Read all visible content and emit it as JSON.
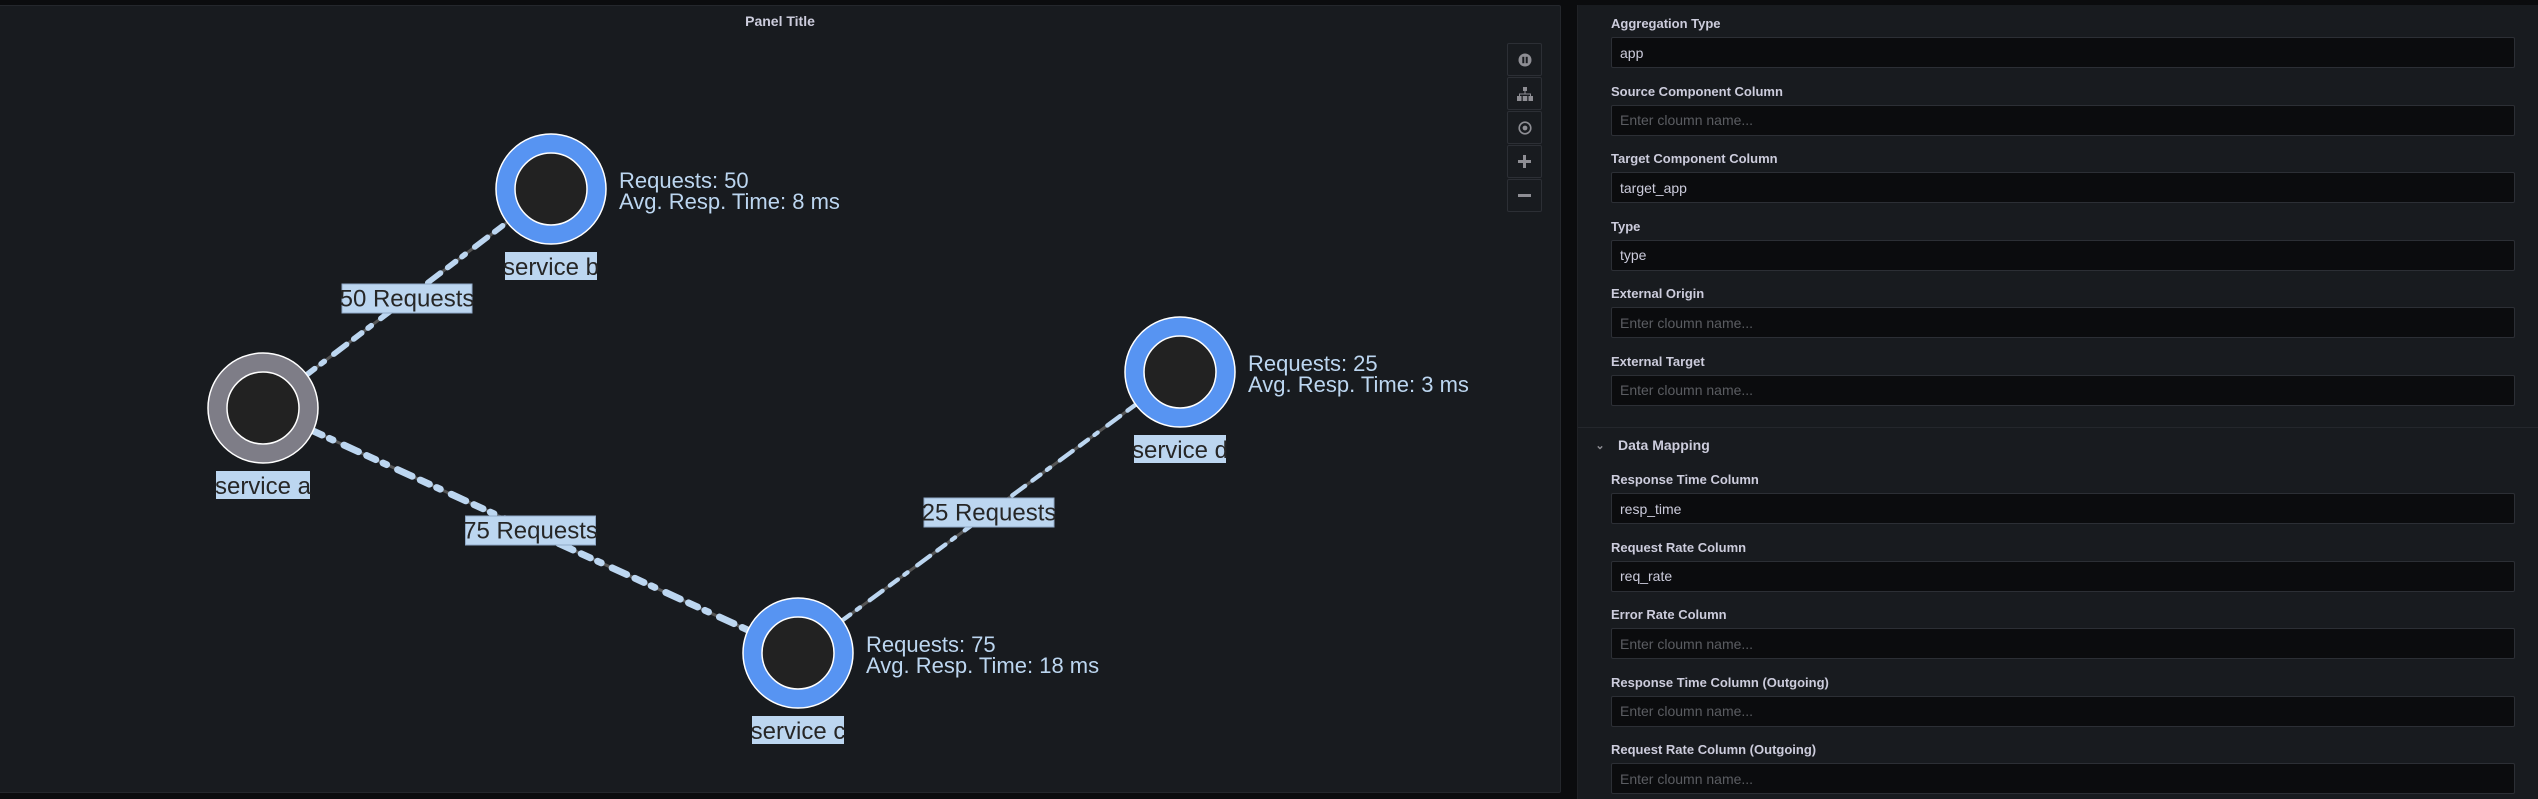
{
  "panel": {
    "title": "Panel Title",
    "toolbar": [
      {
        "name": "pause-button",
        "icon": "pause-circle-icon"
      },
      {
        "name": "layout-button",
        "icon": "sitemap-icon"
      },
      {
        "name": "center-button",
        "icon": "target-icon"
      },
      {
        "name": "zoom-in-button",
        "icon": "plus-icon"
      },
      {
        "name": "zoom-out-button",
        "icon": "minus-icon"
      }
    ],
    "graph": {
      "nodes": [
        {
          "id": "a",
          "label": "service a",
          "color": "#7e7d87",
          "stats": null
        },
        {
          "id": "b",
          "label": "service b",
          "color": "#5794f2",
          "requests_line": "Requests: 50",
          "resp_line": "Avg. Resp. Time: 8 ms"
        },
        {
          "id": "c",
          "label": "service c",
          "color": "#5794f2",
          "requests_line": "Requests: 75",
          "resp_line": "Avg. Resp. Time: 18 ms"
        },
        {
          "id": "d",
          "label": "service d",
          "color": "#5794f2",
          "requests_line": "Requests: 25",
          "resp_line": "Avg. Resp. Time: 3 ms"
        }
      ],
      "edges": [
        {
          "source": "a",
          "target": "b",
          "label": "50 Requests",
          "requests": 50
        },
        {
          "source": "a",
          "target": "c",
          "label": "75 Requests",
          "requests": 75
        },
        {
          "source": "c",
          "target": "d",
          "label": "25 Requests",
          "requests": 25
        }
      ],
      "edge_color": "#bcd6f0",
      "edge_base_color": "#555555"
    }
  },
  "editor": {
    "fields": [
      {
        "label": "Aggregation Type",
        "value": "app",
        "placeholder": ""
      },
      {
        "label": "Source Component Column",
        "value": "",
        "placeholder": "Enter cloumn name..."
      },
      {
        "label": "Target Component Column",
        "value": "target_app",
        "placeholder": ""
      },
      {
        "label": "Type",
        "value": "type",
        "placeholder": ""
      },
      {
        "label": "External Origin",
        "value": "",
        "placeholder": "Enter cloumn name..."
      },
      {
        "label": "External Target",
        "value": "",
        "placeholder": "Enter cloumn name..."
      }
    ],
    "data_mapping": {
      "title": "Data Mapping",
      "expanded": true,
      "fields": [
        {
          "label": "Response Time Column",
          "value": "resp_time",
          "placeholder": ""
        },
        {
          "label": "Request Rate Column",
          "value": "req_rate",
          "placeholder": ""
        },
        {
          "label": "Error Rate Column",
          "value": "",
          "placeholder": "Enter cloumn name..."
        },
        {
          "label": "Response Time Column (Outgoing)",
          "value": "",
          "placeholder": "Enter cloumn name..."
        },
        {
          "label": "Request Rate Column (Outgoing)",
          "value": "",
          "placeholder": "Enter cloumn name..."
        }
      ]
    }
  }
}
